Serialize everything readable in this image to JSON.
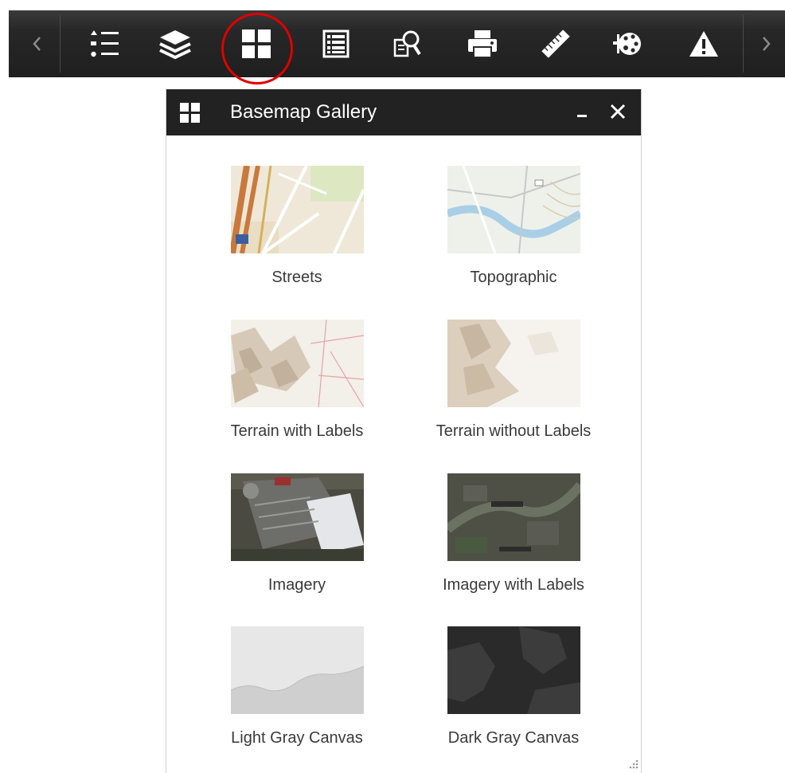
{
  "toolbar": {
    "prev_icon": "chevron-left-icon",
    "next_icon": "chevron-right-icon",
    "tools": [
      {
        "icon": "legend-list-icon"
      },
      {
        "icon": "layers-icon"
      },
      {
        "icon": "basemap-gallery-icon",
        "active": true
      },
      {
        "icon": "attribute-table-icon"
      },
      {
        "icon": "query-icon"
      },
      {
        "icon": "print-icon"
      },
      {
        "icon": "measurement-ruler-icon"
      },
      {
        "icon": "draw-palette-icon"
      },
      {
        "icon": "warning-icon"
      }
    ],
    "highlight_color": "#e00000"
  },
  "panel": {
    "title": "Basemap Gallery",
    "header_bg": "#222222",
    "basemaps": [
      {
        "label": "Streets"
      },
      {
        "label": "Topographic"
      },
      {
        "label": "Terrain with Labels"
      },
      {
        "label": "Terrain without Labels"
      },
      {
        "label": "Imagery"
      },
      {
        "label": "Imagery with Labels"
      },
      {
        "label": "Light Gray Canvas"
      },
      {
        "label": "Dark Gray Canvas"
      }
    ]
  }
}
